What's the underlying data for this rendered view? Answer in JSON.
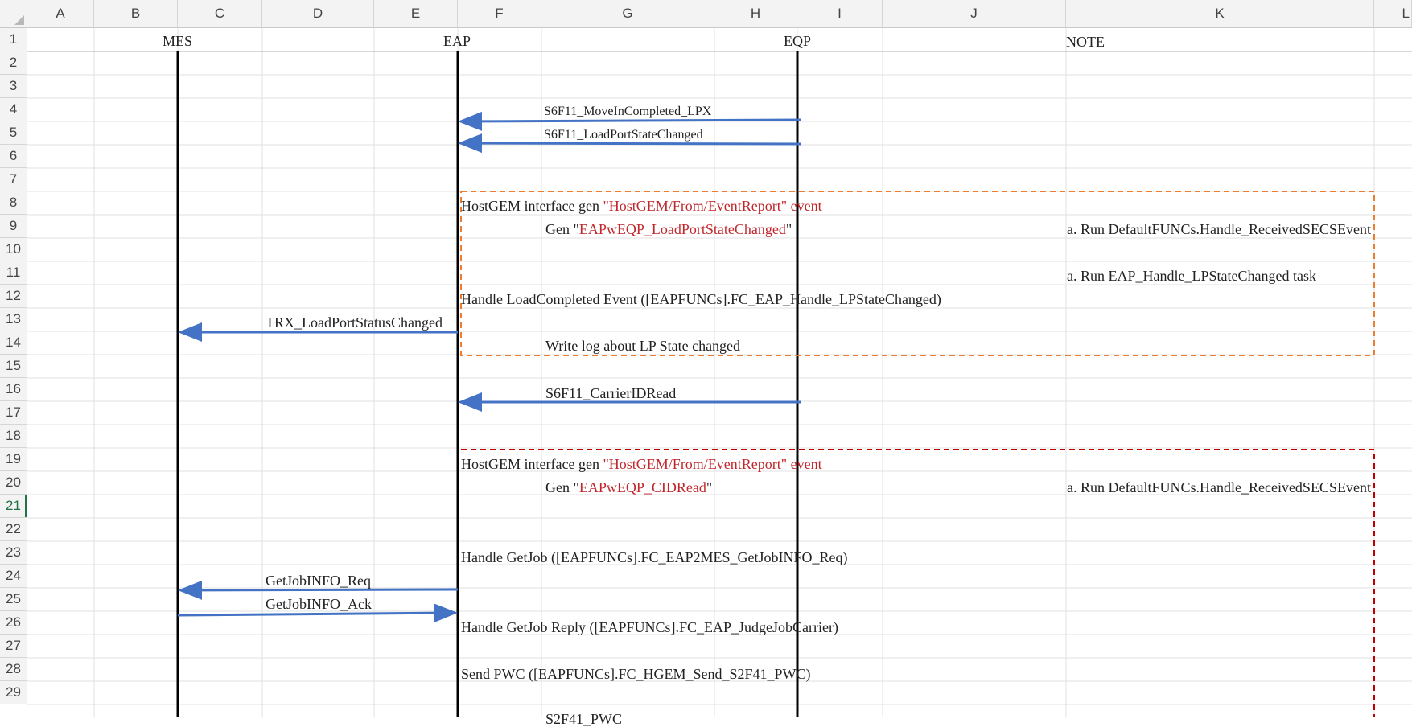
{
  "columns": [
    "A",
    "B",
    "C",
    "D",
    "E",
    "F",
    "G",
    "H",
    "I",
    "J",
    "K",
    "L"
  ],
  "rows": [
    "1",
    "2",
    "3",
    "4",
    "5",
    "6",
    "7",
    "8",
    "9",
    "10",
    "11",
    "12",
    "13",
    "14",
    "15",
    "16",
    "17",
    "18",
    "19",
    "20",
    "21",
    "22",
    "23",
    "24",
    "25",
    "26",
    "27",
    "28",
    "29"
  ],
  "active_row": "21",
  "colors": {
    "lifeline": "#000000",
    "arrow": "#4472c4",
    "orange_box": "#ed7d31",
    "red_box": "#c00000",
    "red_text": "#c0282d",
    "gridline": "#e1e1e1"
  },
  "headers": {
    "mes": "MES",
    "eap": "EAP",
    "eqp": "EQP",
    "note": "NOTE"
  },
  "messages": {
    "move_in": "S6F11_MoveInCompleted_LPX",
    "lp_state": "S6F11_LoadPortStateChanged",
    "carrier_id": "S6F11_CarrierIDRead",
    "trx": "TRX_LoadPortStatusChanged",
    "req": "GetJobINFO_Req",
    "ack": "GetJobINFO_Ack"
  },
  "steps": {
    "hostgem_prefix": "HostGEM interface gen ",
    "hostgem_event": "\"HostGEM/From/EventReport\" event",
    "gen_prefix": "Gen \"",
    "gen1_name": "EAPwEQP_LoadPortStateChanged",
    "gen2_name": "EAPwEQP_CIDRead",
    "gen_suffix": "\"",
    "handle_loadcompleted": "Handle LoadCompleted Event ([EAPFUNCs].FC_EAP_Handle_LPStateChanged)",
    "write_log": "Write log about LP State changed",
    "handle_getjob": "Handle GetJob ([EAPFUNCs].FC_EAP2MES_GetJobINFO_Req)",
    "handle_getjob_reply": "Handle GetJob Reply ([EAPFUNCs].FC_EAP_JudgeJobCarrier)",
    "send_pwc": "Send PWC ([EAPFUNCs].FC_HGEM_Send_S2F41_PWC)",
    "partial_msg": "S2F41_PWC"
  },
  "notes": {
    "note1": "a. Run DefaultFUNCs.Handle_ReceivedSECSEvent",
    "note2": "a. Run EAP_Handle_LPStateChanged task",
    "note3": "a. Run DefaultFUNCs.Handle_ReceivedSECSEvent"
  }
}
